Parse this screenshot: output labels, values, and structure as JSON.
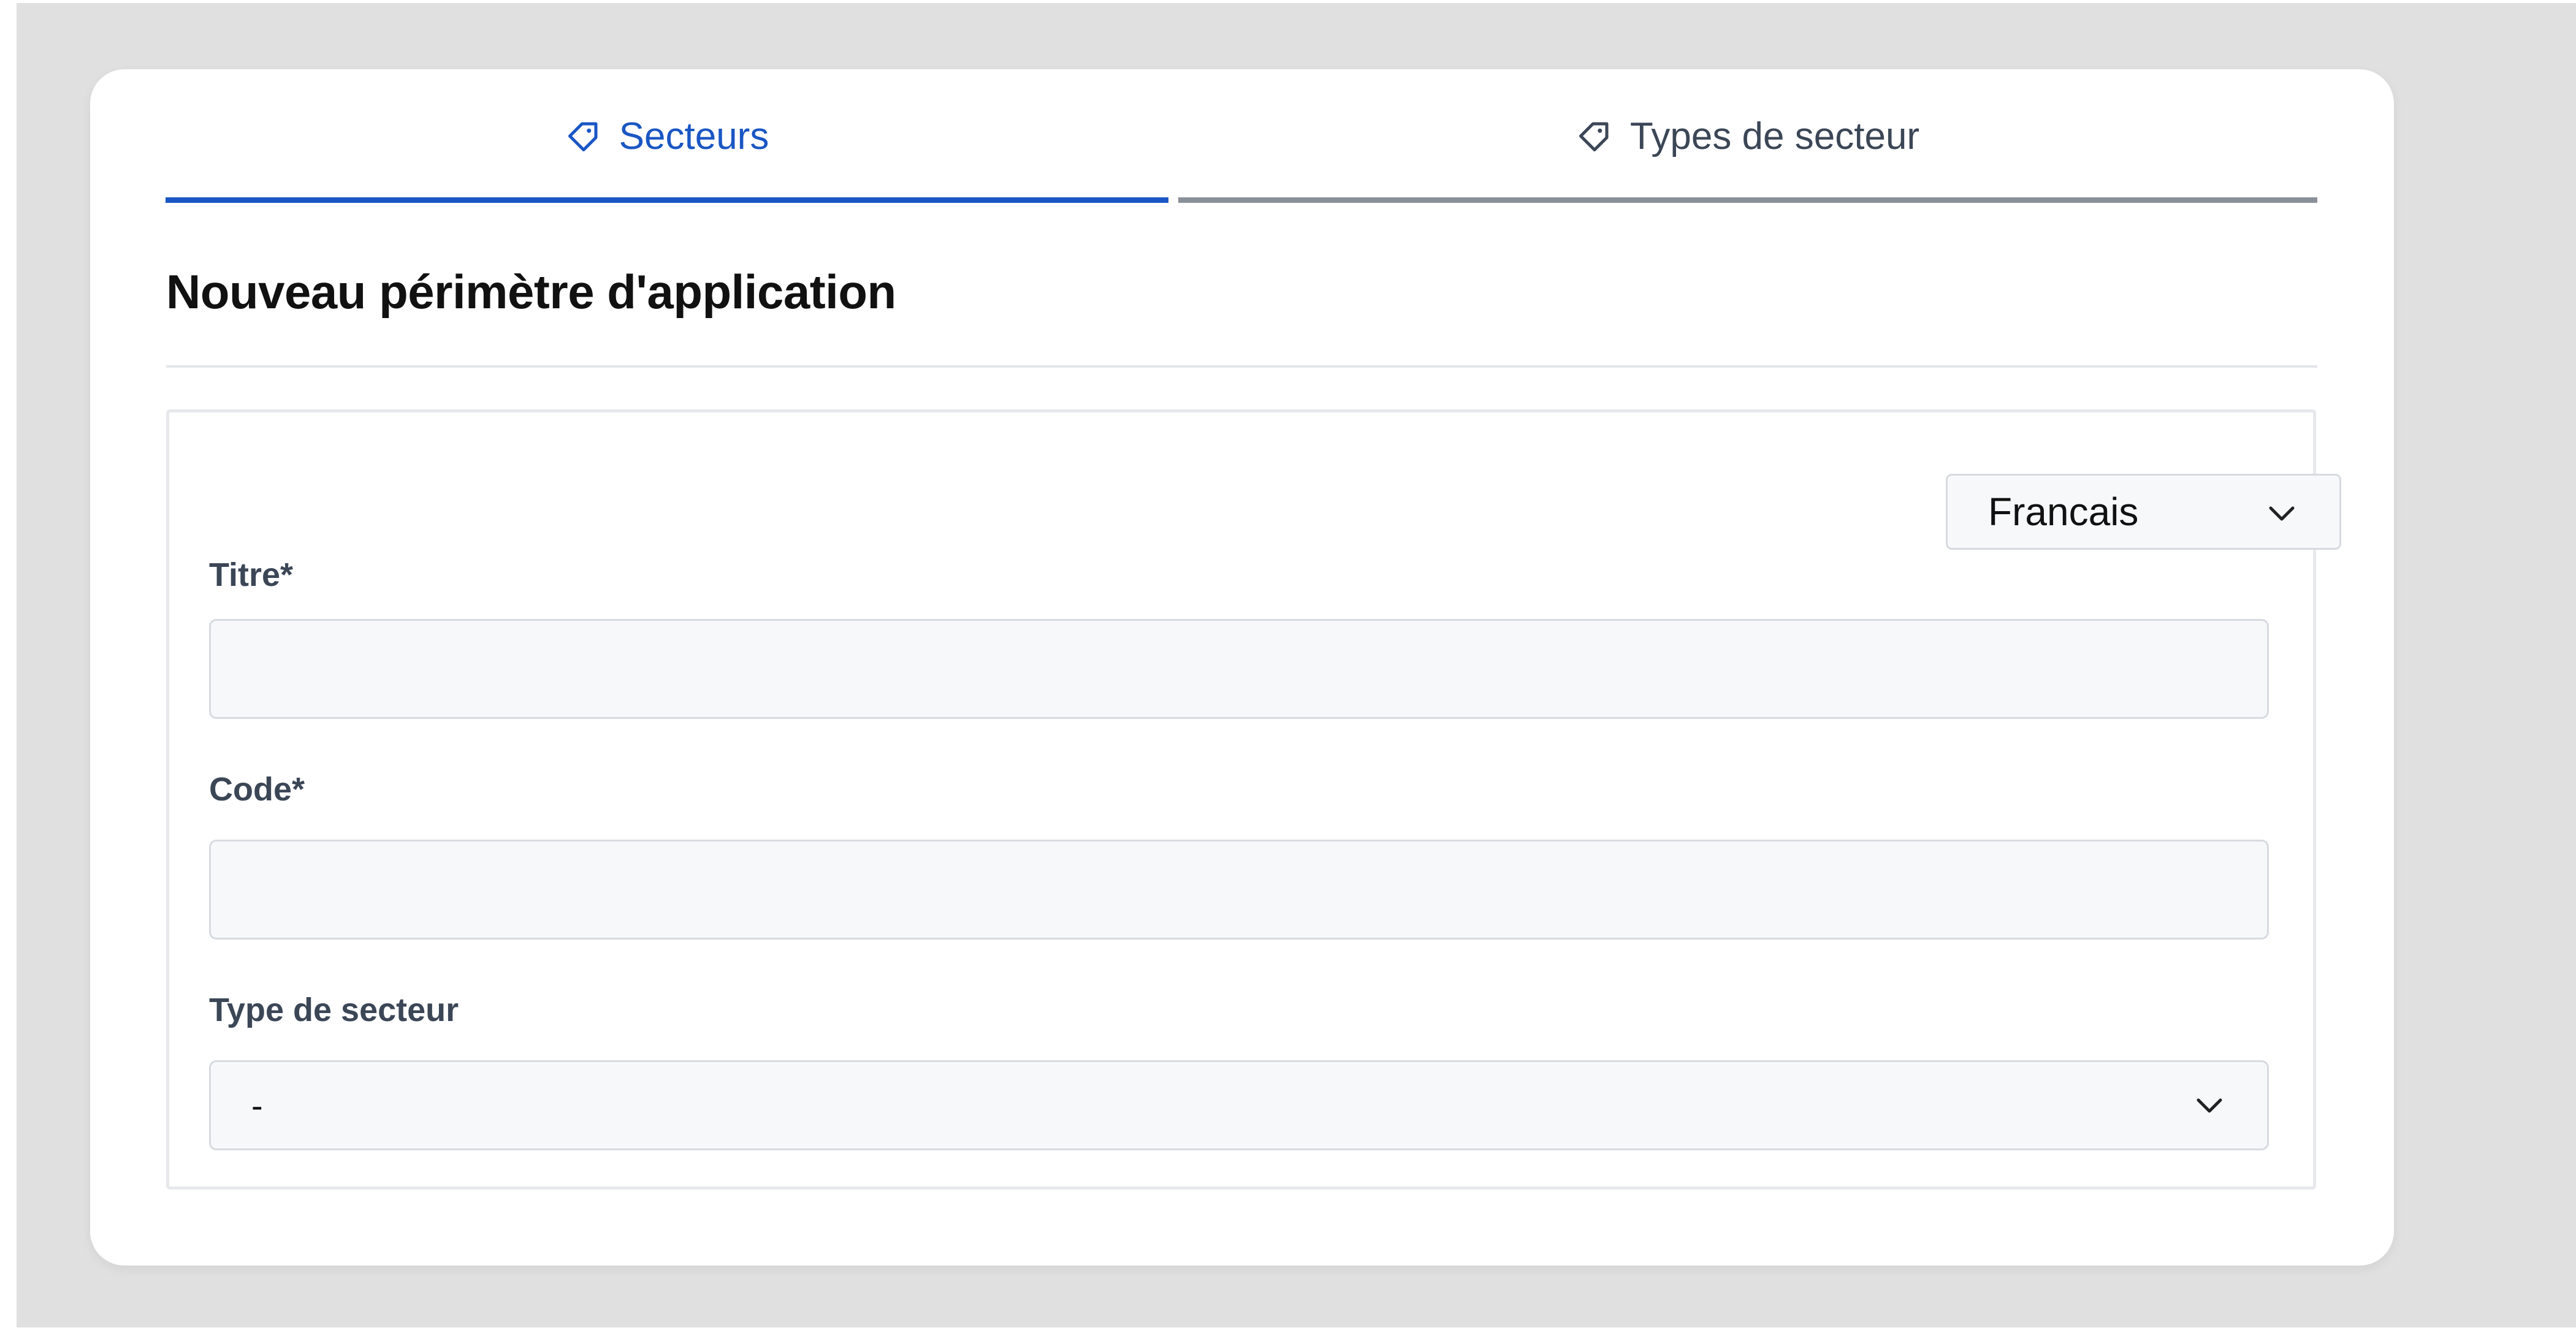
{
  "tabs": [
    {
      "label": "Secteurs",
      "icon": "tag-icon",
      "active": true,
      "color": "#1a56c4"
    },
    {
      "label": "Types de secteur",
      "icon": "tag-icon",
      "active": false,
      "color": "#3b4656"
    }
  ],
  "page": {
    "title": "Nouveau périmètre d'application"
  },
  "form": {
    "language_select": {
      "value": "Francais",
      "icon": "chevron-down-icon"
    },
    "titre": {
      "label": "Titre*",
      "value": "",
      "placeholder": ""
    },
    "code": {
      "label": "Code*",
      "value": "",
      "placeholder": ""
    },
    "type_secteur": {
      "label": "Type de secteur",
      "value": "-",
      "icon": "chevron-down-icon"
    }
  },
  "colors": {
    "accent": "#1a56c4",
    "background": "#e0e0e0",
    "input_background": "#f7f8fa"
  }
}
